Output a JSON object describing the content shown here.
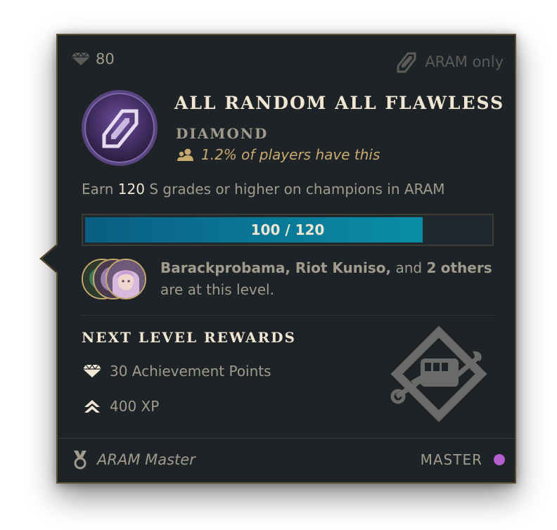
{
  "header": {
    "points_value": "80",
    "mode_label": "ARAM only"
  },
  "achievement": {
    "title": "ALL RANDOM ALL FLAWLESS",
    "tier": "DIAMOND",
    "rarity": "1.2% of players have this",
    "description_prefix": "Earn ",
    "description_count": "120",
    "description_suffix": " S grades or higher on champions in ARAM"
  },
  "progress": {
    "label": "100 / 120",
    "current": 100,
    "max": 120,
    "fraction": 0.8333
  },
  "friends": {
    "names": "Barackprobama, Riot Kuniso,",
    "and_text": " and ",
    "others_count": "2",
    "others_word": "others",
    "suffix": " are at this level."
  },
  "next_rewards": {
    "title": "NEXT LEVEL REWARDS",
    "items": [
      {
        "label": "30 Achievement Points",
        "icon": "gem-icon"
      },
      {
        "label": "400 XP",
        "icon": "xp-chevron-icon"
      }
    ]
  },
  "footer": {
    "title_label": "ARAM Master",
    "rank_label": "MASTER",
    "rank_color": "#b35fd1"
  },
  "colors": {
    "panel_bg": "#1e2328",
    "border_gold": "#5b5036",
    "gold_text": "#c8aa6e",
    "light_text": "#f0e6d2",
    "muted_text": "#a09b8c",
    "progress_fill": "#0a8ea8"
  }
}
